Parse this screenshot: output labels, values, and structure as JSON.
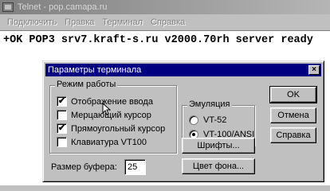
{
  "telnet": {
    "title": "Telnet - pop.camapa.ru",
    "menu": [
      "Подключить",
      "Правка",
      "Терминал",
      "Справка"
    ],
    "terminal_line": "+OK POP3 srv7.kraft-s.ru v2000.70rh server ready"
  },
  "dialog": {
    "title": "Параметры терминала",
    "mode_group": {
      "label": "Режим работы",
      "options": [
        {
          "label": "Отображение ввода",
          "checked": true
        },
        {
          "label": "Мерцающий курсор",
          "checked": false
        },
        {
          "label": "Прямоугольный курсор",
          "checked": true
        },
        {
          "label": "Клавиатура VT100",
          "checked": false
        }
      ]
    },
    "emulation_group": {
      "label": "Эмуляция",
      "options": [
        {
          "label": "VT-52",
          "selected": false
        },
        {
          "label": "VT-100/ANSI",
          "selected": true
        }
      ]
    },
    "buffer": {
      "label": "Размер буфера:",
      "value": "25"
    },
    "buttons": {
      "fonts": "Шрифты...",
      "background": "Цвет фона...",
      "ok": "OK",
      "cancel": "Отмена",
      "help": "Справка"
    },
    "check_mark": "✔"
  }
}
